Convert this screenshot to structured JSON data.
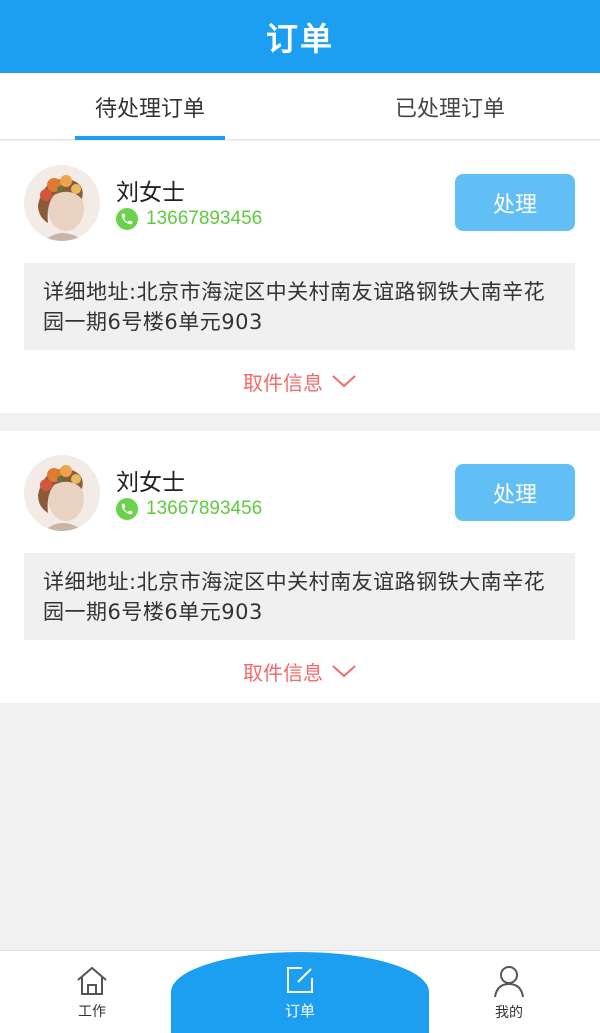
{
  "header": {
    "title": "订单"
  },
  "tabs": [
    {
      "label": "待处理订单",
      "active": true
    },
    {
      "label": "已处理订单",
      "active": false
    }
  ],
  "orders": [
    {
      "name": "刘女士",
      "phone": "13667893456",
      "action_label": "处理",
      "address": "详细地址:北京市海淀区中关村南友谊路钢铁大南辛花园一期6号楼6单元903",
      "expand_label": "取件信息"
    },
    {
      "name": "刘女士",
      "phone": "13667893456",
      "action_label": "处理",
      "address": "详细地址:北京市海淀区中关村南友谊路钢铁大南辛花园一期6号楼6单元903",
      "expand_label": "取件信息"
    }
  ],
  "bottom_nav": [
    {
      "label": "工作",
      "icon": "home-icon"
    },
    {
      "label": "订单",
      "icon": "edit-icon",
      "active": true
    },
    {
      "label": "我的",
      "icon": "user-icon"
    }
  ],
  "colors": {
    "primary": "#1c9ff1",
    "button": "#62bff5",
    "phone": "#5fca3f",
    "expand": "#f26a6a"
  }
}
